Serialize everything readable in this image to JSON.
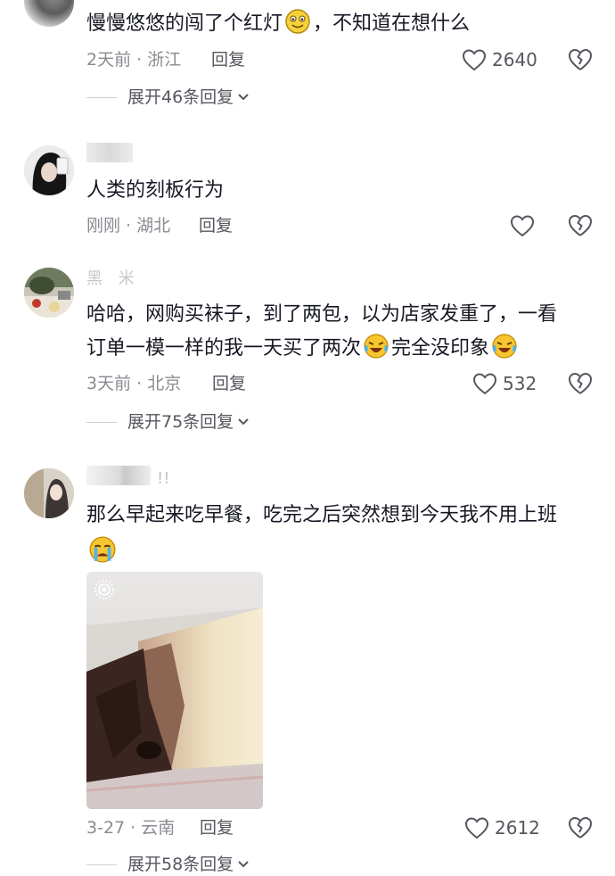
{
  "comments": [
    {
      "text": "慢慢悠悠的闯了个红灯",
      "text_after": "，不知道在想什么",
      "emoji": "smile-emoji",
      "time_location": "2天前 · 浙江",
      "reply_label": "回复",
      "likes": "2640",
      "expand_label": "展开46条回复"
    },
    {
      "text": "人类的刻板行为",
      "time_location": "刚刚 · 湖北",
      "reply_label": "回复",
      "likes": ""
    },
    {
      "username": "黑 米",
      "text_line1": "哈哈，网购买袜子，到了两包，以为店家发重了，一看",
      "text_line2": "订单一模一样的我一天买了两次",
      "text_line2_after": "完全没印象",
      "emoji": "crying-laugh-emoji",
      "time_location": "3天前 · 北京",
      "reply_label": "回复",
      "likes": "532",
      "expand_label": "展开75条回复"
    },
    {
      "username_suffix": "!!",
      "text": "那么早起来吃早餐，吃完之后突然想到今天我不用上班",
      "emoji": "crying-emoji",
      "time_location": "3-27 · 云南",
      "reply_label": "回复",
      "likes": "2612",
      "expand_label": "展开58条回复"
    }
  ],
  "colors": {
    "text": "#161823",
    "meta": "#8a8b91",
    "secondary": "#55575e"
  }
}
